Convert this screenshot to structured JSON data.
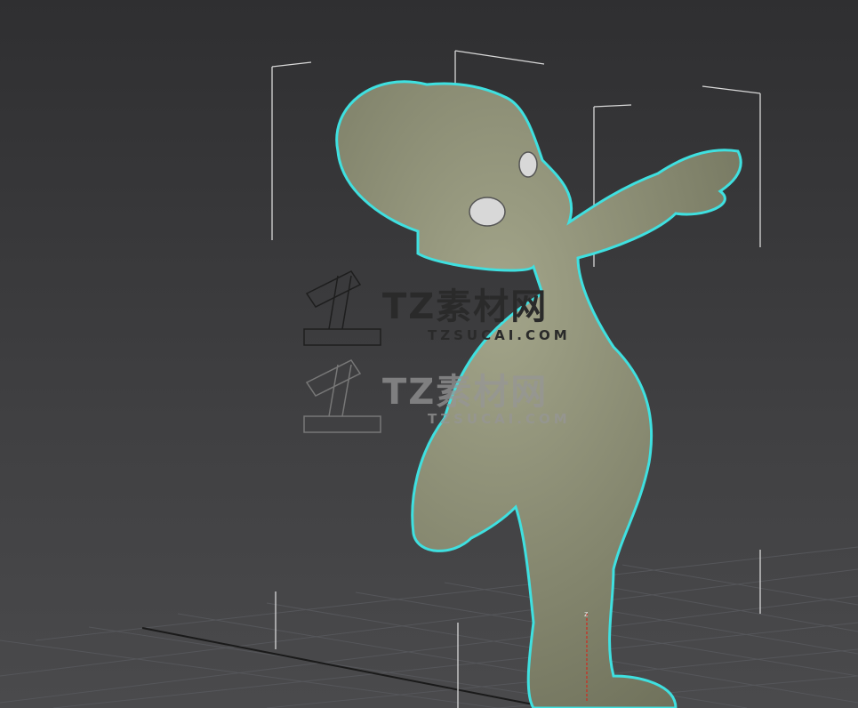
{
  "viewport": {
    "selection_outline_color": "#3fe0e0",
    "model_color": "#8a8c73",
    "background_color": "#3b3b3d"
  },
  "watermarks": [
    {
      "title": "TZ素材网",
      "url": "TZSUCAI.COM"
    },
    {
      "title": "TZ素材网",
      "url": "TZSUCAI.COM"
    }
  ],
  "gizmo": {
    "axis_label": "z"
  }
}
